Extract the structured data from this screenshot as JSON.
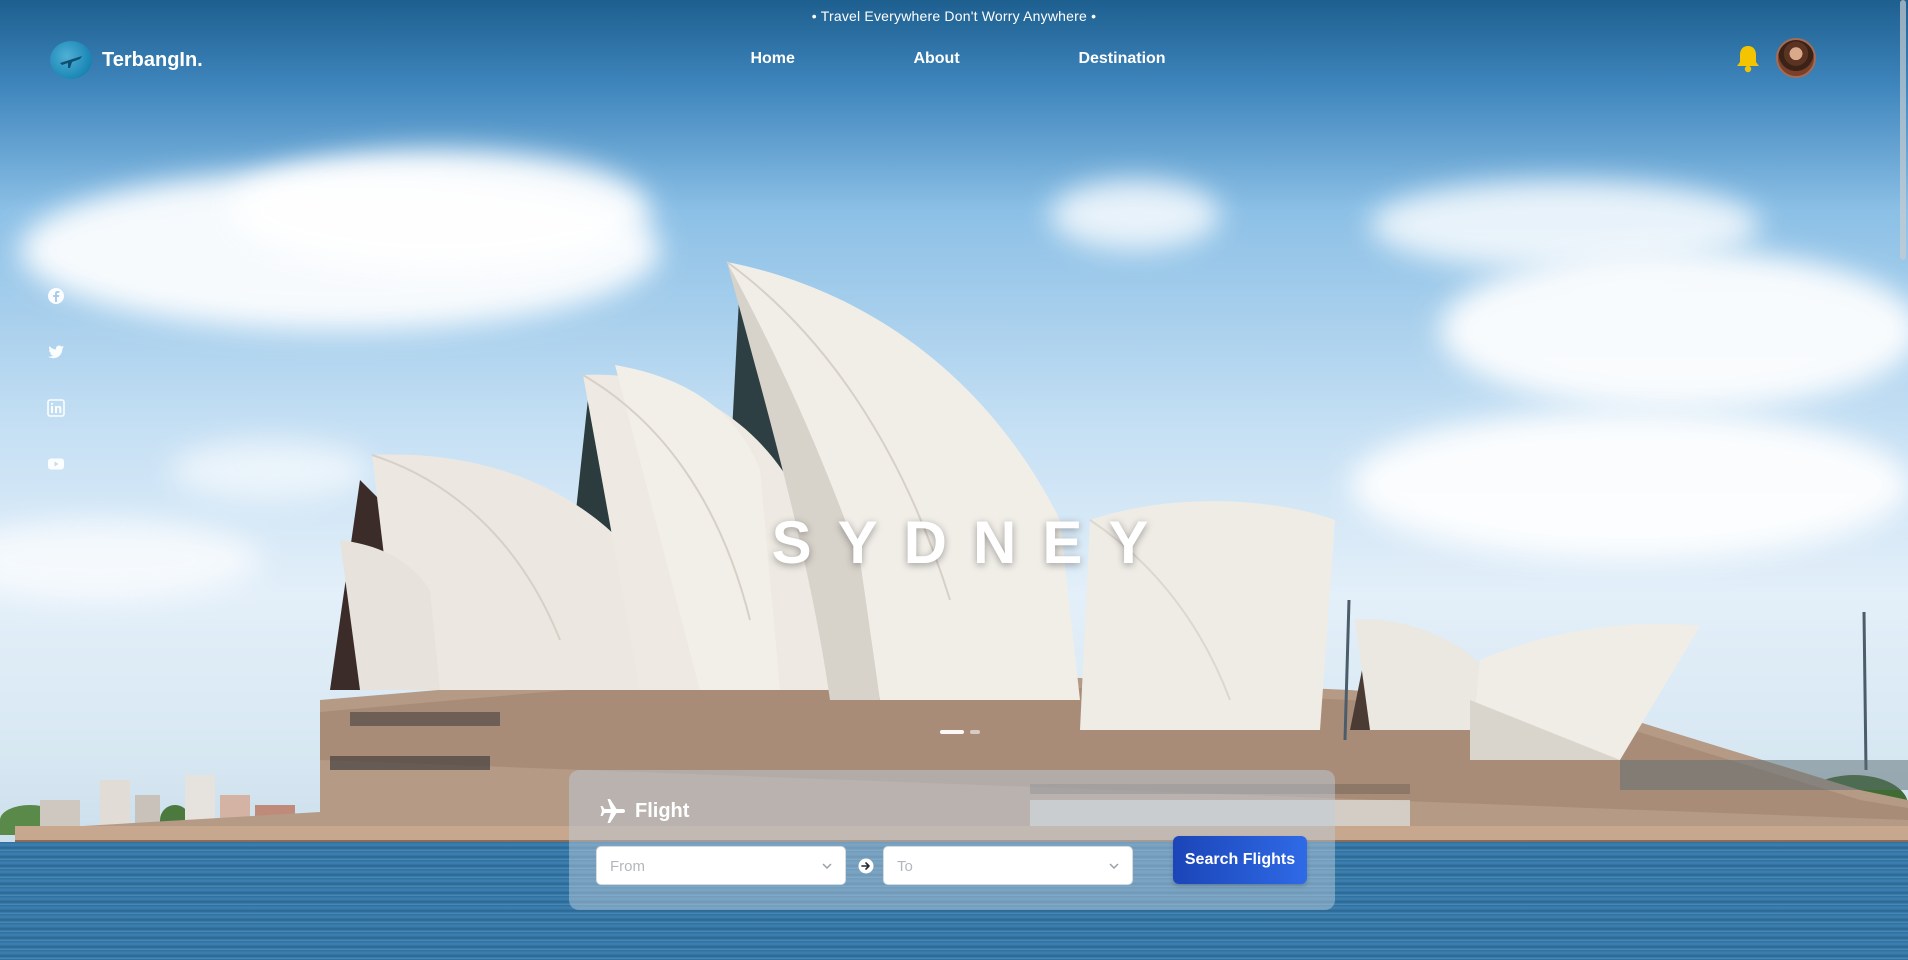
{
  "header": {
    "tagline": "• Travel Everywhere Don't Worry Anywhere •",
    "brand_name": "TerbangIn.",
    "logo_icon": "plane-globe-icon",
    "nav": [
      {
        "label": "Home"
      },
      {
        "label": "About"
      },
      {
        "label": "Destination"
      }
    ],
    "notification_icon": "bell-icon",
    "avatar_icon": "user-avatar"
  },
  "social": [
    {
      "name": "facebook-icon"
    },
    {
      "name": "twitter-icon"
    },
    {
      "name": "linkedin-icon"
    },
    {
      "name": "youtube-icon"
    }
  ],
  "hero": {
    "title": "SYDNEY",
    "slides_total": 2,
    "active_slide": 1
  },
  "search": {
    "title": "Flight",
    "title_icon": "airplane-icon",
    "from_placeholder": "From",
    "to_placeholder": "To",
    "swap_icon": "arrow-right-circle-icon",
    "button_label": "Search Flights"
  },
  "colors": {
    "brand_blue": "#1a86b4",
    "button_start": "#1b45b8",
    "button_end": "#2f6ae6",
    "bell": "#f5c400"
  }
}
